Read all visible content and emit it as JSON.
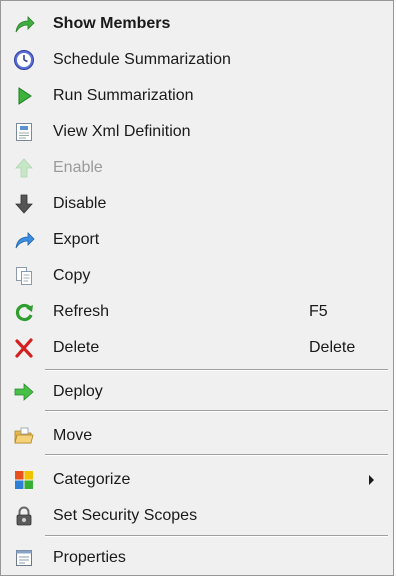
{
  "menu": {
    "show_members": {
      "label": "Show Members",
      "icon": "green-curved-arrow-icon"
    },
    "schedule_summarization": {
      "label": "Schedule Summarization",
      "icon": "clock-icon"
    },
    "run_summarization": {
      "label": "Run Summarization",
      "icon": "play-icon"
    },
    "view_xml_definition": {
      "label": "View Xml Definition",
      "icon": "document-icon"
    },
    "enable": {
      "label": "Enable",
      "icon": "up-arrow-icon",
      "disabled": true
    },
    "disable": {
      "label": "Disable",
      "icon": "down-arrow-icon"
    },
    "export": {
      "label": "Export",
      "icon": "blue-curved-arrow-icon"
    },
    "copy": {
      "label": "Copy",
      "icon": "copy-icon"
    },
    "refresh": {
      "label": "Refresh",
      "shortcut": "F5",
      "icon": "refresh-icon"
    },
    "delete": {
      "label": "Delete",
      "shortcut": "Delete",
      "icon": "red-x-icon"
    },
    "deploy": {
      "label": "Deploy",
      "icon": "green-right-arrow-icon"
    },
    "move": {
      "label": "Move",
      "icon": "folder-icon"
    },
    "categorize": {
      "label": "Categorize",
      "icon": "color-squares-icon",
      "has_submenu": true
    },
    "set_security_scopes": {
      "label": "Set Security Scopes",
      "icon": "padlock-icon"
    },
    "properties": {
      "label": "Properties",
      "icon": "properties-icon"
    }
  },
  "colors": {
    "menu_background": "#f0f0f0",
    "border": "#979797",
    "text": "#1a1a1a",
    "disabled_text": "#9a9a9a"
  }
}
